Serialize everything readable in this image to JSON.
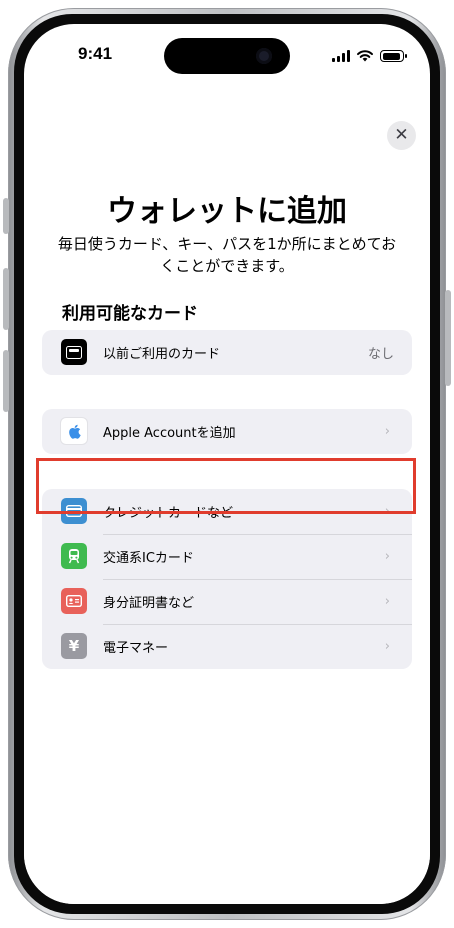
{
  "status_bar": {
    "time": "9:41"
  },
  "sheet": {
    "close_label": "✕",
    "title": "ウォレットに追加",
    "subtitle": "毎日使うカード、キー、パスを1か所にまとめておくことができます。",
    "section_label": "利用可能なカード",
    "previous_cards": {
      "label": "以前ご利用のカード",
      "value": "なし"
    },
    "apple_account": {
      "label": "Apple Accountを追加"
    },
    "card_types": [
      {
        "label": "クレジットカードなど",
        "icon": "credit-card-icon",
        "color": "#3d8fd1"
      },
      {
        "label": "交通系ICカード",
        "icon": "train-icon",
        "color": "#3fba4f"
      },
      {
        "label": "身分証明書など",
        "icon": "id-card-icon",
        "color": "#e8615a"
      },
      {
        "label": "電子マネー",
        "icon": "yen-icon",
        "color": "#9a9aa1"
      }
    ],
    "chevron": "›"
  },
  "colors": {
    "highlight": "#e03c2d",
    "group_bg": "#efeff4"
  }
}
